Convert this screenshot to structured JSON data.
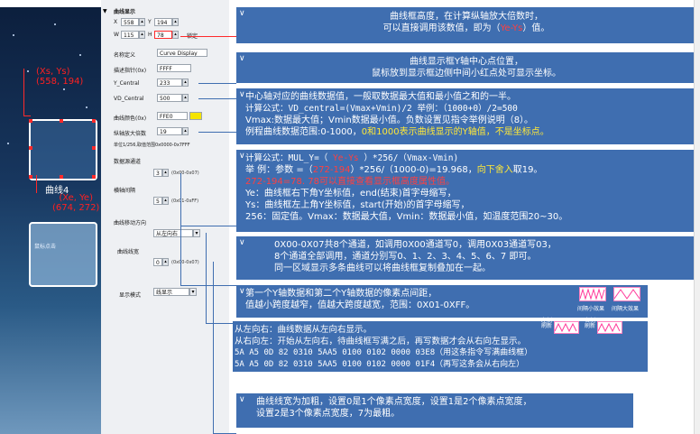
{
  "canvas": {
    "red_coord_top_label": "(Xs, Ys)",
    "red_coord_top_value": "(558, 194)",
    "curve_label": "曲线4",
    "red_coord_bottom_label": "(Xe, Ye)",
    "red_coord_bottom_value": "(674, 272)",
    "cursor_label": "鼠标点击"
  },
  "panel": {
    "section_title": "曲线显示",
    "x_label": "X",
    "x_value": "558",
    "y_label": "Y",
    "y_value": "194",
    "w_label": "W",
    "w_value": "115",
    "h_label": "H",
    "h_value": "78",
    "lock_label": "锁定",
    "name_label": "名称定义",
    "name_value": "Curve Display",
    "desc_label": "描述指针(0x)",
    "desc_value": "FFFF",
    "ycentral_label": "Y_Central",
    "ycentral_value": "233",
    "vdcentral_label": "VD_Central",
    "vdcentral_value": "500",
    "color_label": "曲线颜色(0x)",
    "color_value": "FFE0",
    "color_swatch": "#f5e400",
    "mul_label": "纵轴放大倍数",
    "mul_value": "19",
    "unit_text": "单位1/256,取值范围0x0000-0x7FFF",
    "channel_label": "数据源通道",
    "channel_value": "3",
    "channel_range": "(0x00-0x07)",
    "dis_label": "横轴间隔",
    "dis_value": "5",
    "dis_range": "(0x01-0xFF)",
    "dir_label": "曲线移动方向",
    "dir_value": "从左向右",
    "width_label": "曲线线宽",
    "width_value": "0",
    "width_range": "(0x00-0x07)",
    "mode_label": "显示模式",
    "mode_value": "线显示"
  },
  "box1": {
    "line1": "曲线框高度，在计算纵轴放大倍数时，",
    "line2a": "可以直接调用该数值，即为（",
    "line2b": "Ye-Ys",
    "line2c": "）值。"
  },
  "box2": {
    "line1": "曲线显示框Y轴中心点位置，",
    "line2": "鼠标放到显示框边侧中间小红点处可显示坐标。"
  },
  "box3": {
    "line1": "中心轴对应的曲线数据值，一般取数据最大值和最小值之和的一半。",
    "line2": "计算公式：VD_central=(Vmax+Vmin)/2  举例：（1000+0）/2=500",
    "line3": "Vmax:数据最大值；Vmin数据最小值。负数设置见指令举例说明（8）。",
    "line4a": "例程曲线数据范围:0-1000，",
    "line4b": "0和1000表示曲线显示的Y轴值，不是坐标点。"
  },
  "box4": {
    "line1a": "计算公式：MUL_Y=（",
    "line1b": " Ye-Ys ",
    "line1c": "）*256/（Vmax-Vmin)",
    "line2a": "举    例：参数 =（",
    "line2b": "272-194",
    "line2c": "）*256/（1000-0)=19.968，",
    "line2d": "向下舍入",
    "line2e": "取19。",
    "line3": "272-194=78.  78可以直接查看显示框高度属性值。",
    "line4": "Ye：曲线框右下角Y坐标值，end(结束)首字母缩写，",
    "line5": "Ys：曲线框左上角Y坐标值，start(开始)的首字母缩写，",
    "line6": "256：固定值。Vmax：数据最大值，Vmin：数据最小值，如温度范围20~30。"
  },
  "box5": {
    "line1": "0X00-0X07共8个通道，如调用0X00通道写0，调用0X03通道写03，",
    "line2": "8个通道全部调用，通道分别写0、1、2、3、4、5、6、7 即可。",
    "line3": "同一区域显示多条曲线可以将曲线框复制叠加在一起。"
  },
  "box6": {
    "line1": "第一个Y轴数据和第二个Y轴数据的像素点间距，",
    "line2": "值越小跨度越窄，值越大跨度越宽，范围：0X01-0XFF。",
    "wave1_label": "间隔小效果",
    "wave2_label": "间隔大效果"
  },
  "box7": {
    "line1": "从左向右：曲线数据从左向右显示。",
    "line2": "从右向左：开始从左向右，待曲线框写满之后，再写数据才会从右向左显示。",
    "line3": "5A A5 0D 82 0310 5AA5 0100 0102 0000 03E8（用这条指令写满曲线框）",
    "line4": "5A A5 0D 82 0310 5AA5 0100 0102 0000 01F4（再写这条会从右向左）",
    "left_refresh": "左侧刷新",
    "right_refresh": "右侧刷新"
  },
  "box8": {
    "line1": "曲线线宽为加粗，设置0是1个像素点宽度，设置1是2个像素点宽度，",
    "line2": "设置2是3个像素点宽度，7为最粗。"
  }
}
